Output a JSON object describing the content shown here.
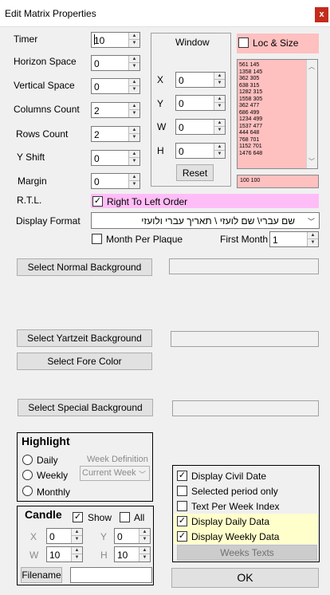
{
  "window": {
    "title": "Edit Matrix Properties",
    "close_label": "x"
  },
  "fields": [
    {
      "label": "Timer",
      "value": "10"
    },
    {
      "label": "Horizon Space",
      "value": "0"
    },
    {
      "label": "Vertical Space",
      "value": "0"
    },
    {
      "label": "Columns Count",
      "value": "2"
    },
    {
      "label": "Rows Count",
      "value": "2"
    },
    {
      "label": "Y Shift",
      "value": "0"
    },
    {
      "label": "Margin",
      "value": "0"
    }
  ],
  "window_group": {
    "title": "Window",
    "x_label": "X",
    "x_value": "0",
    "y_label": "Y",
    "y_value": "0",
    "w_label": "W",
    "w_value": "0",
    "h_label": "H",
    "h_value": "0",
    "reset_label": "Reset"
  },
  "loc_size": {
    "label": "Loc & Size",
    "checked": false,
    "list_items": [
      "561 145",
      "1358 145",
      "362 305",
      "638 315",
      "1282 315",
      "1558 305",
      "362 477",
      "686 499",
      "1234 499",
      "1537 477",
      "444 648",
      "768 701",
      "1152 701",
      "1476 648"
    ],
    "current_value": "100 100"
  },
  "rtl": {
    "label": "R.T.L.",
    "checkbox_label": "Right To Left Order",
    "checked": true
  },
  "display_format": {
    "label": "Display Format",
    "value": "שם עברי\\ שם לועזי \\ תאריך עברי ולועזי"
  },
  "month_per_plaque": {
    "label": "Month Per Plaque",
    "checked": false
  },
  "first_month": {
    "label": "First Month",
    "value": "1"
  },
  "buttons": {
    "normal_bg": "Select Normal Background",
    "yartzeit_bg": "Select Yartzeit Background",
    "fore_color": "Select Fore Color",
    "special_bg": "Select Special Background",
    "filename": "Filename",
    "weeks_texts": "Weeks Texts",
    "ok": "OK"
  },
  "highlight": {
    "title": "Highlight",
    "options": [
      "Daily",
      "Weekly",
      "Monthly"
    ],
    "week_definition_label": "Week Definition",
    "week_definition_value": "Current Week"
  },
  "candle": {
    "title": "Candle",
    "show_label": "Show",
    "show_checked": true,
    "all_label": "All",
    "all_checked": false,
    "x_label": "X",
    "x_value": "0",
    "y_label": "Y",
    "y_value": "0",
    "w_label": "W",
    "w_value": "10",
    "h_label": "H",
    "h_value": "10"
  },
  "options": [
    {
      "label": "Display Civil Date",
      "checked": true
    },
    {
      "label": "Selected period only",
      "checked": false
    },
    {
      "label": "Text Per Week Index",
      "checked": false
    },
    {
      "label": "Display Daily Data",
      "checked": true
    },
    {
      "label": "Display Weekly Data",
      "checked": true
    }
  ],
  "colors": {
    "pink": "#ffc0c0",
    "magenta": "#ffbdf7",
    "light_yellow": "#ffffcc",
    "close_red": "#c42b1c"
  }
}
